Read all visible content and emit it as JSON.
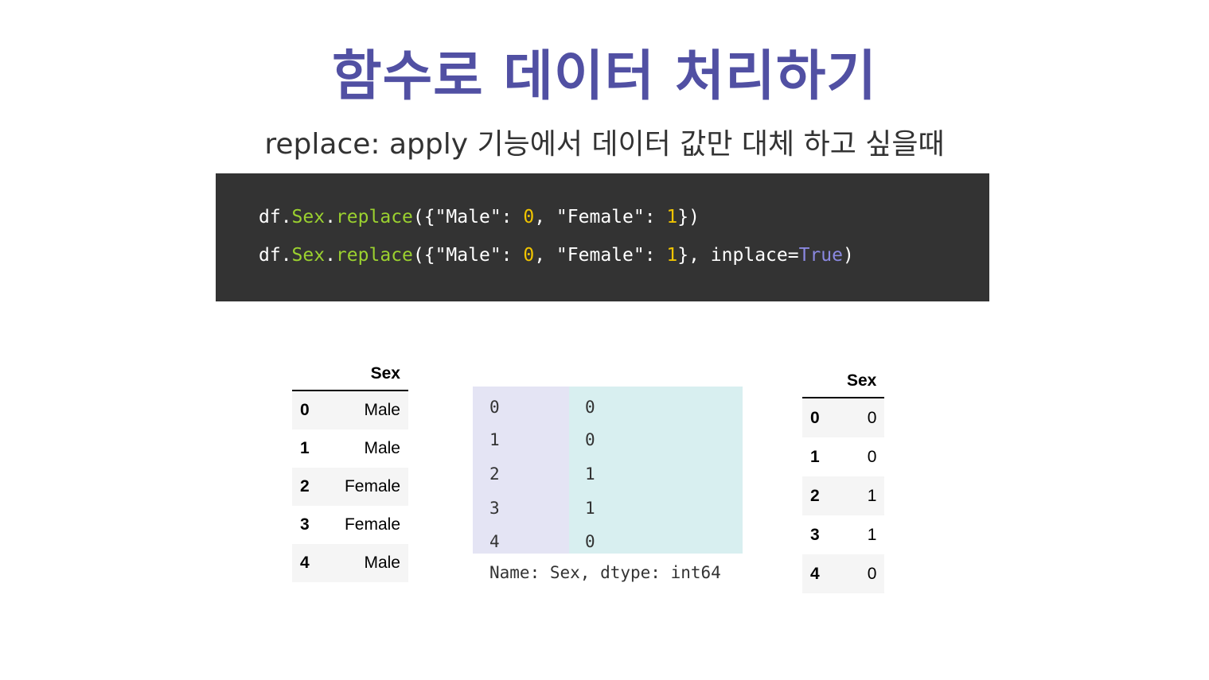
{
  "title": "함수로 데이터 처리하기",
  "subtitle": "replace: apply 기능에서 데이터 값만 대체 하고 싶을때",
  "code": {
    "lines": [
      [
        {
          "t": "df.",
          "c": "white"
        },
        {
          "t": "Sex",
          "c": "green"
        },
        {
          "t": ".",
          "c": "white"
        },
        {
          "t": "replace",
          "c": "green"
        },
        {
          "t": "({\"Male\": ",
          "c": "white"
        },
        {
          "t": "0",
          "c": "yellow"
        },
        {
          "t": ", \"Female\": ",
          "c": "white"
        },
        {
          "t": "1",
          "c": "yellow"
        },
        {
          "t": "})",
          "c": "white"
        }
      ],
      [
        {
          "t": "df.",
          "c": "white"
        },
        {
          "t": "Sex",
          "c": "green"
        },
        {
          "t": ".",
          "c": "white"
        },
        {
          "t": "replace",
          "c": "green"
        },
        {
          "t": "({\"Male\": ",
          "c": "white"
        },
        {
          "t": "0",
          "c": "yellow"
        },
        {
          "t": ", \"Female\": ",
          "c": "white"
        },
        {
          "t": "1",
          "c": "yellow"
        },
        {
          "t": "}, inplace=",
          "c": "white"
        },
        {
          "t": "True",
          "c": "purple"
        },
        {
          "t": ")",
          "c": "white"
        }
      ]
    ]
  },
  "left_table": {
    "header": "Sex",
    "rows": [
      {
        "index": "0",
        "value": "Male"
      },
      {
        "index": "1",
        "value": "Male"
      },
      {
        "index": "2",
        "value": "Female"
      },
      {
        "index": "3",
        "value": "Female"
      },
      {
        "index": "4",
        "value": "Male"
      }
    ]
  },
  "series": {
    "index": [
      "0",
      "1",
      "2",
      "3",
      "4"
    ],
    "values": [
      "0",
      "0",
      "1",
      "1",
      "0"
    ],
    "footer": "Name: Sex, dtype: int64"
  },
  "right_table": {
    "header": "Sex",
    "rows": [
      {
        "index": "0",
        "value": "0"
      },
      {
        "index": "1",
        "value": "0"
      },
      {
        "index": "2",
        "value": "1"
      },
      {
        "index": "3",
        "value": "1"
      },
      {
        "index": "4",
        "value": "0"
      }
    ]
  }
}
